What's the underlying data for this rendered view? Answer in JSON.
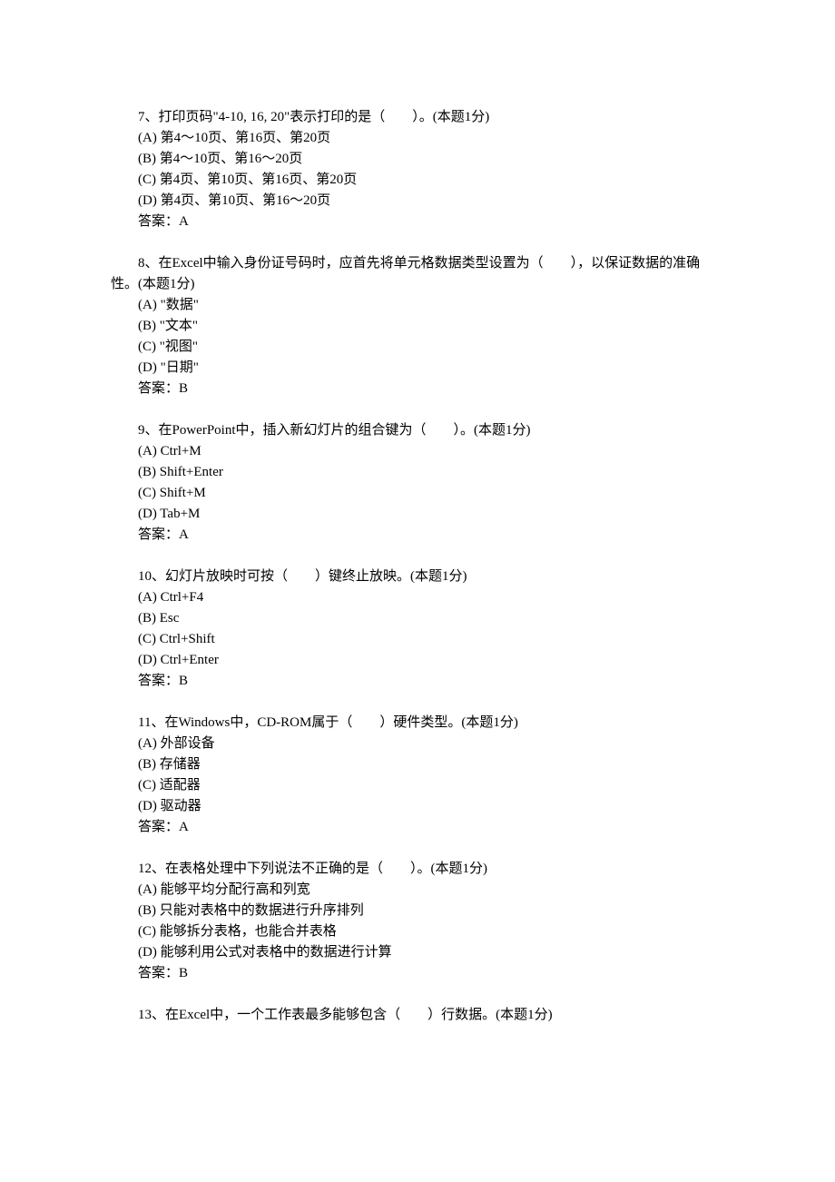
{
  "questions": [
    {
      "stem": "7、打印页码\"4-10, 16, 20\"表示打印的是（　　）。(本题1分)",
      "options": [
        "(A) 第4～10页、第16页、第20页",
        "(B) 第4～10页、第16～20页",
        "(C) 第4页、第10页、第16页、第20页",
        "(D) 第4页、第10页、第16～20页"
      ],
      "answer": "答案：A"
    },
    {
      "stem": "8、在Excel中输入身份证号码时，应首先将单元格数据类型设置为（　　），以保证数据的准确性。(本题1分)",
      "options": [
        "(A) \"数据\"",
        "(B) \"文本\"",
        "(C) \"视图\"",
        "(D) \"日期\""
      ],
      "answer": "答案：B"
    },
    {
      "stem": "9、在PowerPoint中，插入新幻灯片的组合键为（　　）。(本题1分)",
      "options": [
        "(A) Ctrl+M",
        "(B) Shift+Enter",
        "(C) Shift+M",
        "(D) Tab+M"
      ],
      "answer": "答案：A"
    },
    {
      "stem": "10、幻灯片放映时可按（　　）键终止放映。(本题1分)",
      "options": [
        "(A) Ctrl+F4",
        "(B) Esc",
        "(C) Ctrl+Shift",
        "(D) Ctrl+Enter"
      ],
      "answer": "答案：B"
    },
    {
      "stem": "11、在Windows中，CD-ROM属于（　　）硬件类型。(本题1分)",
      "options": [
        "(A) 外部设备",
        "(B) 存储器",
        "(C) 适配器",
        "(D) 驱动器"
      ],
      "answer": "答案：A"
    },
    {
      "stem": "12、在表格处理中下列说法不正确的是（　　）。(本题1分)",
      "options": [
        "(A) 能够平均分配行高和列宽",
        "(B) 只能对表格中的数据进行升序排列",
        "(C) 能够拆分表格，也能合并表格",
        "(D) 能够利用公式对表格中的数据进行计算"
      ],
      "answer": "答案：B"
    },
    {
      "stem": "13、在Excel中，一个工作表最多能够包含（　　）行数据。(本题1分)",
      "options": [],
      "answer": ""
    }
  ]
}
